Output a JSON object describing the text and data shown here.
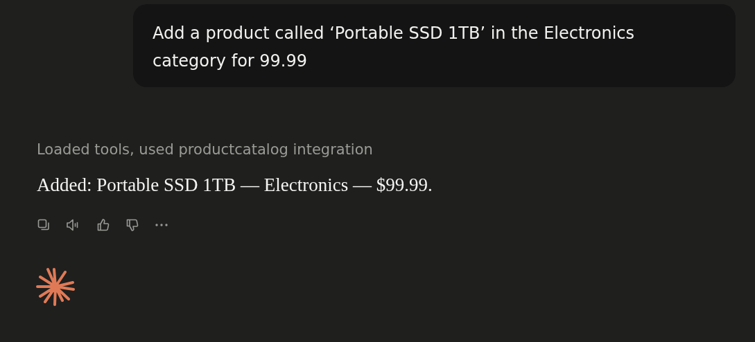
{
  "user_message": {
    "text": "Add a product called ‘Portable SSD 1TB’ in the Electronics category for 99.99"
  },
  "assistant": {
    "status": "Loaded tools, used productcatalog integration",
    "reply": "Added: Portable SSD 1TB — Electronics — $99.99.",
    "actions": [
      {
        "kind": "copy"
      },
      {
        "kind": "speak"
      },
      {
        "kind": "like"
      },
      {
        "kind": "dislike"
      },
      {
        "kind": "more"
      }
    ]
  }
}
